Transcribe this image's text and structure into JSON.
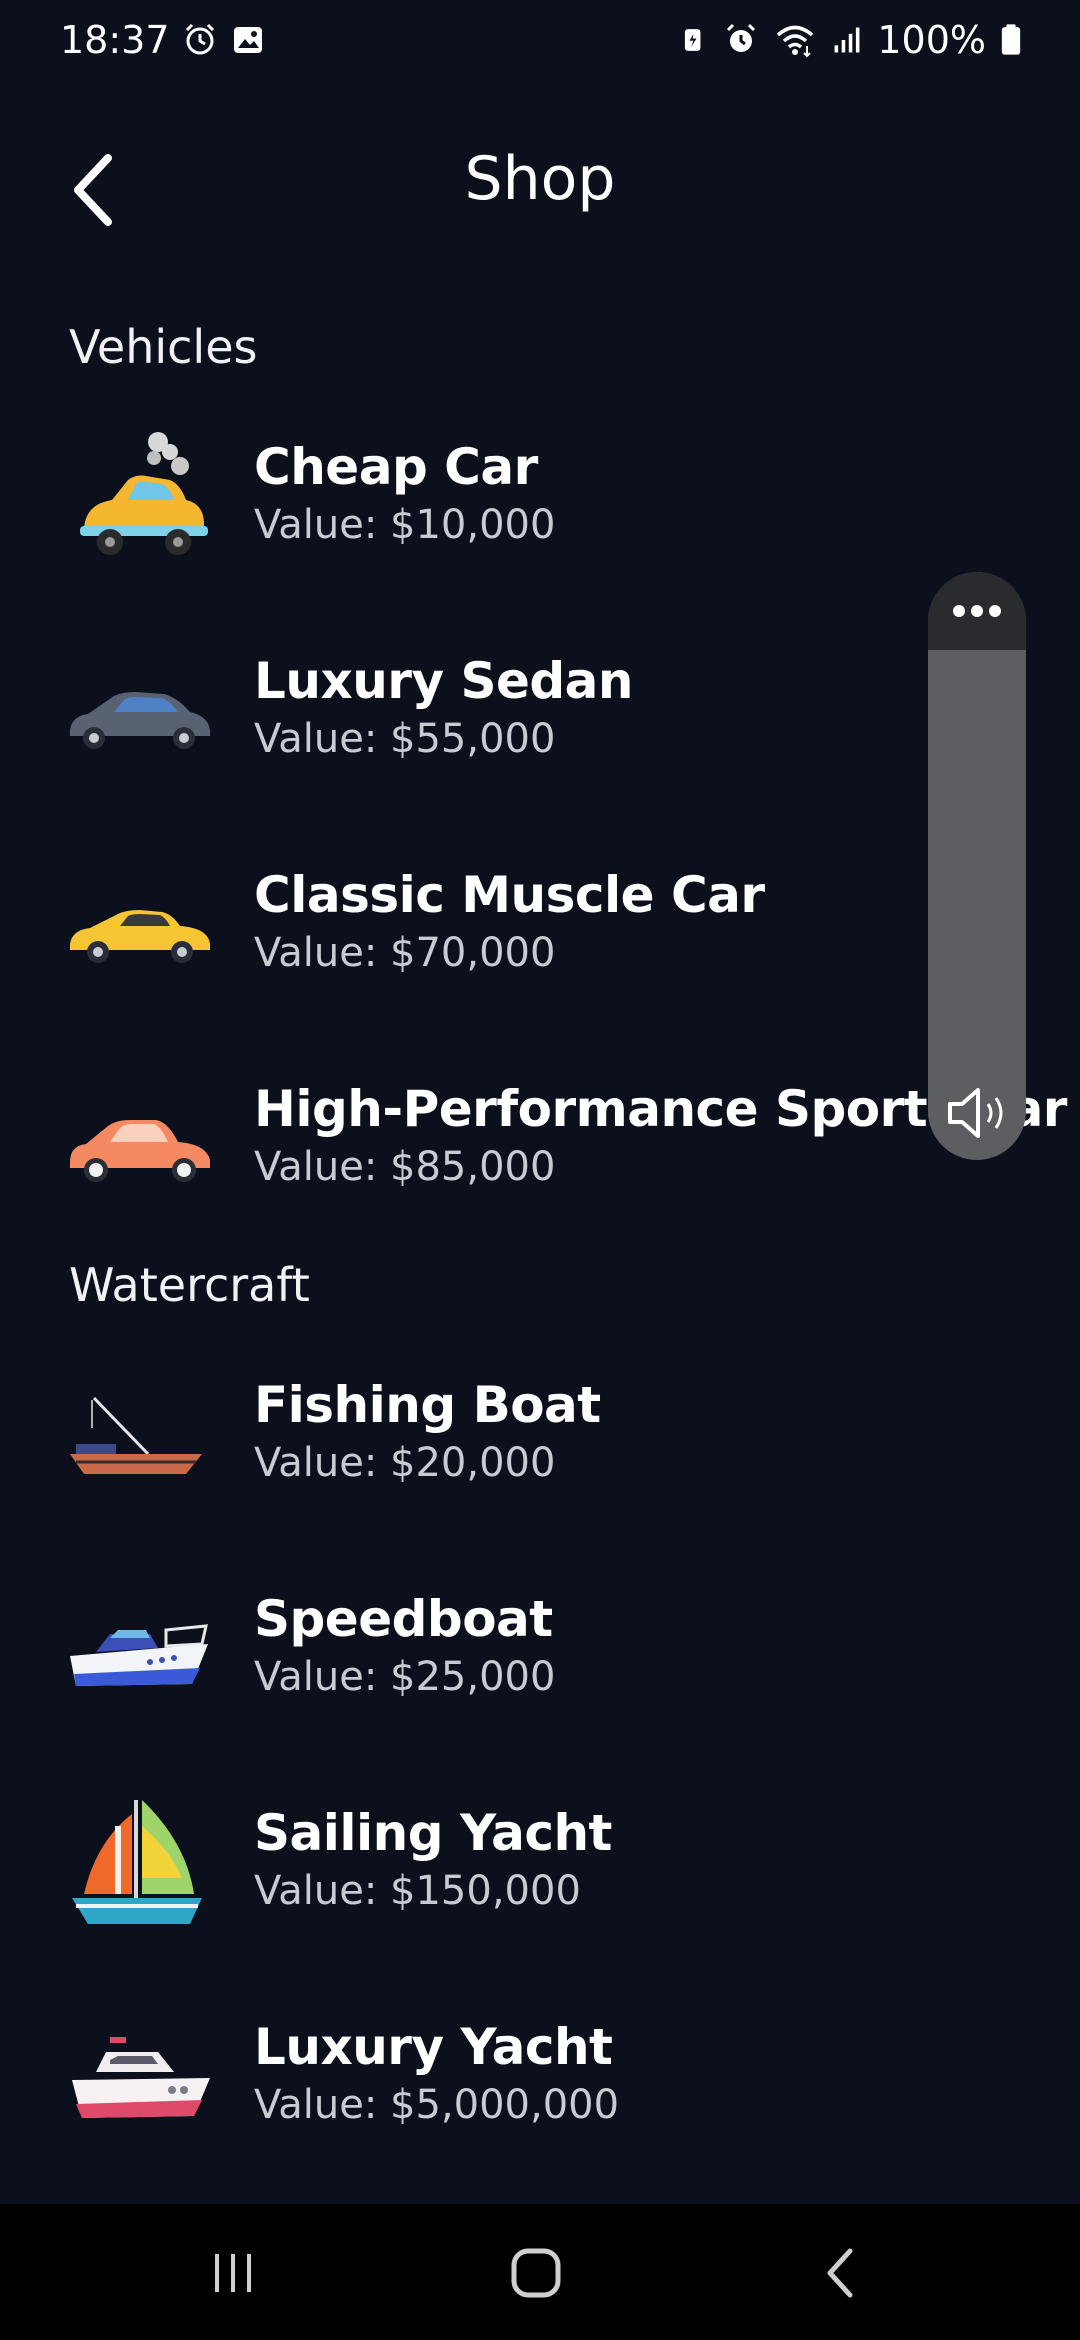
{
  "status_bar": {
    "time": "18:37",
    "battery": "100%",
    "left_icons": [
      "alarm-clock-icon",
      "gallery-icon"
    ],
    "right_icons": [
      "battery-saver-icon",
      "alarm-icon",
      "wifi-icon",
      "signal-icon",
      "battery-icon"
    ]
  },
  "header": {
    "title": "Shop",
    "back_icon": "chevron-left-icon"
  },
  "sections": [
    {
      "title": "Vehicles",
      "items": [
        {
          "name": "Cheap Car",
          "value": "Value: $10,000",
          "icon": "smoking-car-icon"
        },
        {
          "name": "Luxury Sedan",
          "value": "Value: $55,000",
          "icon": "sedan-icon"
        },
        {
          "name": "Classic Muscle Car",
          "value": "Value: $70,000",
          "icon": "muscle-car-icon"
        },
        {
          "name": "High-Performance Sports Car",
          "value": "Value: $85,000",
          "icon": "sports-car-icon"
        }
      ]
    },
    {
      "title": "Watercraft",
      "items": [
        {
          "name": "Fishing Boat",
          "value": "Value: $20,000",
          "icon": "fishing-boat-icon"
        },
        {
          "name": "Speedboat",
          "value": "Value: $25,000",
          "icon": "speedboat-icon"
        },
        {
          "name": "Sailing Yacht",
          "value": "Value: $150,000",
          "icon": "sailboat-icon"
        },
        {
          "name": "Luxury Yacht",
          "value": "Value: $5,000,000",
          "icon": "yacht-icon"
        }
      ]
    }
  ],
  "volume_panel": {
    "menu_icon": "more-dots-icon",
    "speaker_icon": "speaker-icon"
  },
  "nav_bar": {
    "buttons": [
      "recents-icon",
      "home-icon",
      "back-icon"
    ]
  },
  "colors": {
    "background": "#0c0f1c",
    "text_primary": "#ffffff",
    "text_secondary": "#c9cbd2",
    "volume_panel": "#5d5e62"
  }
}
